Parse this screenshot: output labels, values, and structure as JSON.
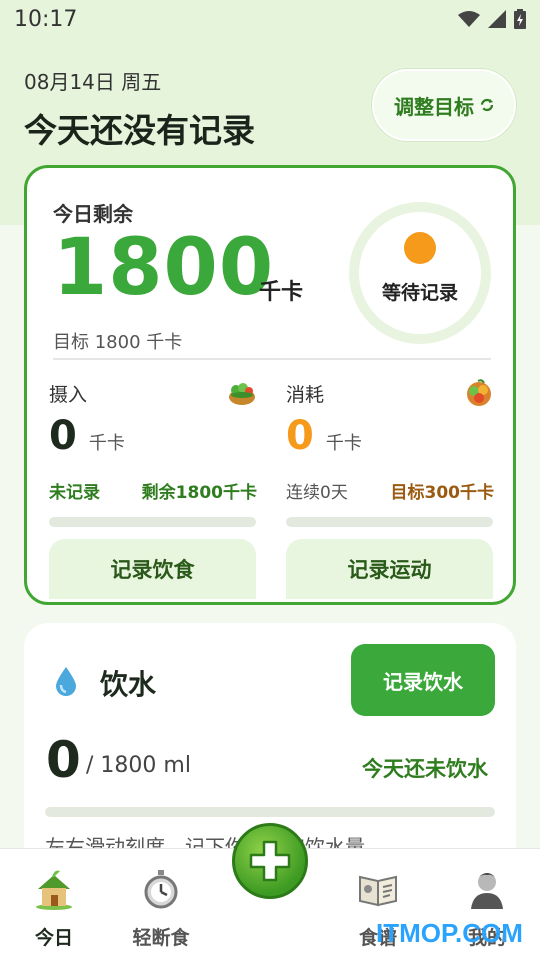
{
  "status_bar": {
    "time": "10:17",
    "icons": [
      "wifi-icon",
      "signal-icon",
      "battery-icon"
    ]
  },
  "header": {
    "date": "08月14日 周五",
    "title": "今天还没有记录",
    "adjust_button": "调整目标"
  },
  "calorie_card": {
    "remaining_label": "今日剩余",
    "remaining_value": "1800",
    "unit": "千卡",
    "goal_text": "目标 1800 千卡",
    "ring_status": "等待记录",
    "intake": {
      "title": "摄入",
      "value": "0",
      "unit": "千卡",
      "status": "未记录",
      "remaining": "剩余1800千卡",
      "button": "记录饮食",
      "icon": "salad-icon"
    },
    "burn": {
      "title": "消耗",
      "value": "0",
      "unit": "千卡",
      "streak": "连续0天",
      "goal": "目标300千卡",
      "button": "记录运动",
      "icon": "fruit-basket-icon"
    }
  },
  "water_card": {
    "title": "饮水",
    "button": "记录饮水",
    "value": "0",
    "goal": "/ 1800 ml",
    "status": "今天还未饮水",
    "hint": "左右滑动刻度，记下你的真实饮水量"
  },
  "bottom_nav": {
    "items": [
      {
        "label": "今日",
        "icon": "house-icon",
        "active": true
      },
      {
        "label": "轻断食",
        "icon": "stopwatch-icon",
        "active": false
      },
      {
        "label": "食谱",
        "icon": "recipe-book-icon",
        "active": false
      },
      {
        "label": "我的",
        "icon": "profile-icon",
        "active": false
      }
    ],
    "fab_icon": "plus-icon"
  },
  "watermark": "ITMOP.COM",
  "colors": {
    "accent": "#3aa83a",
    "accent_dark": "#2f7d1f",
    "orange": "#f59a1b",
    "header_bg": "#e6f4dc"
  }
}
